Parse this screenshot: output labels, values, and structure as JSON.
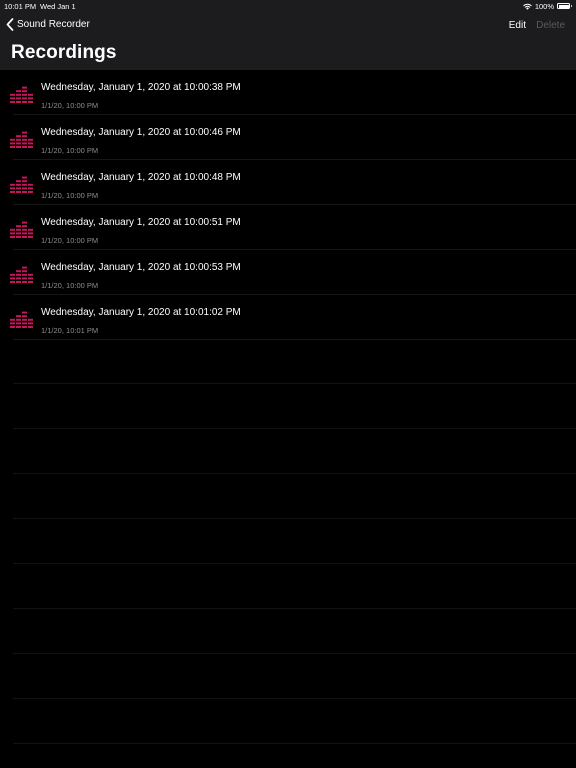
{
  "status_bar": {
    "time": "10:01 PM",
    "date": "Wed Jan 1",
    "battery": "100%"
  },
  "nav": {
    "back_label": "Sound Recorder",
    "edit_label": "Edit",
    "delete_label": "Delete"
  },
  "title": "Recordings",
  "recordings": [
    {
      "title": "Wednesday, January 1, 2020 at 10:00:38 PM",
      "subtitle": "1/1/20, 10:00 PM"
    },
    {
      "title": "Wednesday, January 1, 2020 at 10:00:46 PM",
      "subtitle": "1/1/20, 10:00 PM"
    },
    {
      "title": "Wednesday, January 1, 2020 at 10:00:48 PM",
      "subtitle": "1/1/20, 10:00 PM"
    },
    {
      "title": "Wednesday, January 1, 2020 at 10:00:51 PM",
      "subtitle": "1/1/20, 10:00 PM"
    },
    {
      "title": "Wednesday, January 1, 2020 at 10:00:53 PM",
      "subtitle": "1/1/20, 10:00 PM"
    },
    {
      "title": "Wednesday, January 1, 2020 at 10:01:02 PM",
      "subtitle": "1/1/20, 10:01 PM"
    }
  ],
  "icons": {
    "back": "chevron-left-icon",
    "wifi": "wifi-icon",
    "battery": "battery-icon",
    "recording": "audio-levels-icon"
  },
  "colors": {
    "background": "#000000",
    "header": "#1c1c1e",
    "icon_accent": "#c2185b",
    "disabled": "#5a5a5e",
    "secondary_text": "#8e8e93"
  }
}
